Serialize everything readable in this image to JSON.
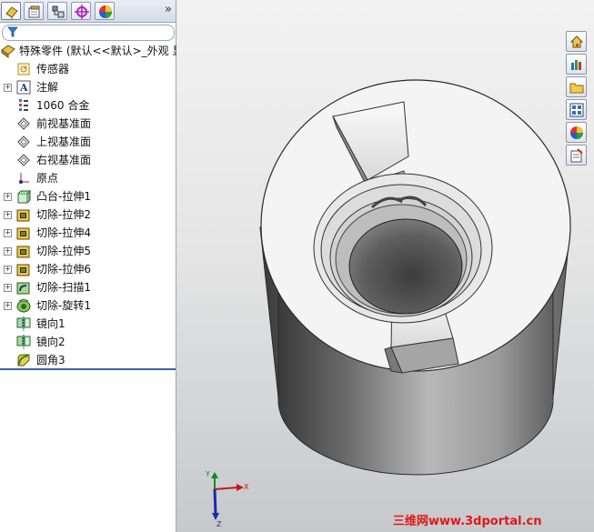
{
  "feature_manager": {
    "expand_symbol": "»",
    "tabs": [
      {
        "name": "featuremanager-tab",
        "icon": "feature-tree-icon",
        "active": true
      },
      {
        "name": "propertymanager-tab",
        "icon": "property-manager-icon"
      },
      {
        "name": "configurationmanager-tab",
        "icon": "configuration-icon"
      },
      {
        "name": "dimxpert-tab",
        "icon": "dimxpert-crosshair-icon"
      },
      {
        "name": "display-manager-tab",
        "icon": "appearance-ball-icon"
      }
    ],
    "filter_icon": "filter-icon",
    "tree": [
      {
        "label": "特殊零件  (默认<<默认>_外观 显",
        "icon": "part-icon",
        "expander": false,
        "root": true
      },
      {
        "label": "传感器",
        "icon": "sensor-icon",
        "expander": false
      },
      {
        "label": "注解",
        "icon": "annotation-icon",
        "expander": true
      },
      {
        "label": "1060 合金",
        "icon": "material-icon",
        "expander": false
      },
      {
        "label": "前视基准面",
        "icon": "plane-icon",
        "expander": false
      },
      {
        "label": "上视基准面",
        "icon": "plane-icon",
        "expander": false
      },
      {
        "label": "右视基准面",
        "icon": "plane-icon",
        "expander": false
      },
      {
        "label": "原点",
        "icon": "origin-icon",
        "expander": false
      },
      {
        "label": "凸台-拉伸1",
        "icon": "boss-extrude-icon",
        "expander": true
      },
      {
        "label": "切除-拉伸2",
        "icon": "cut-extrude-icon",
        "expander": true
      },
      {
        "label": "切除-拉伸4",
        "icon": "cut-extrude-icon",
        "expander": true
      },
      {
        "label": "切除-拉伸5",
        "icon": "cut-extrude-icon",
        "expander": true
      },
      {
        "label": "切除-拉伸6",
        "icon": "cut-extrude-icon",
        "expander": true
      },
      {
        "label": "切除-扫描1",
        "icon": "cut-sweep-icon",
        "expander": true
      },
      {
        "label": "切除-旋转1",
        "icon": "cut-revolve-icon",
        "expander": true
      },
      {
        "label": "镜向1",
        "icon": "mirror-icon",
        "expander": false
      },
      {
        "label": "镜向2",
        "icon": "mirror-icon",
        "expander": false
      },
      {
        "label": "圆角3",
        "icon": "fillet-icon",
        "expander": false
      }
    ]
  },
  "task_pane": [
    {
      "name": "home-icon"
    },
    {
      "name": "design-library-icon"
    },
    {
      "name": "file-explorer-icon"
    },
    {
      "name": "view-palette-icon"
    },
    {
      "name": "appearances-icon"
    },
    {
      "name": "custom-properties-icon"
    }
  ],
  "triad": {
    "y": "Y",
    "x": "X",
    "z": "Z"
  },
  "watermark": "三维网www.3dportal.cn"
}
